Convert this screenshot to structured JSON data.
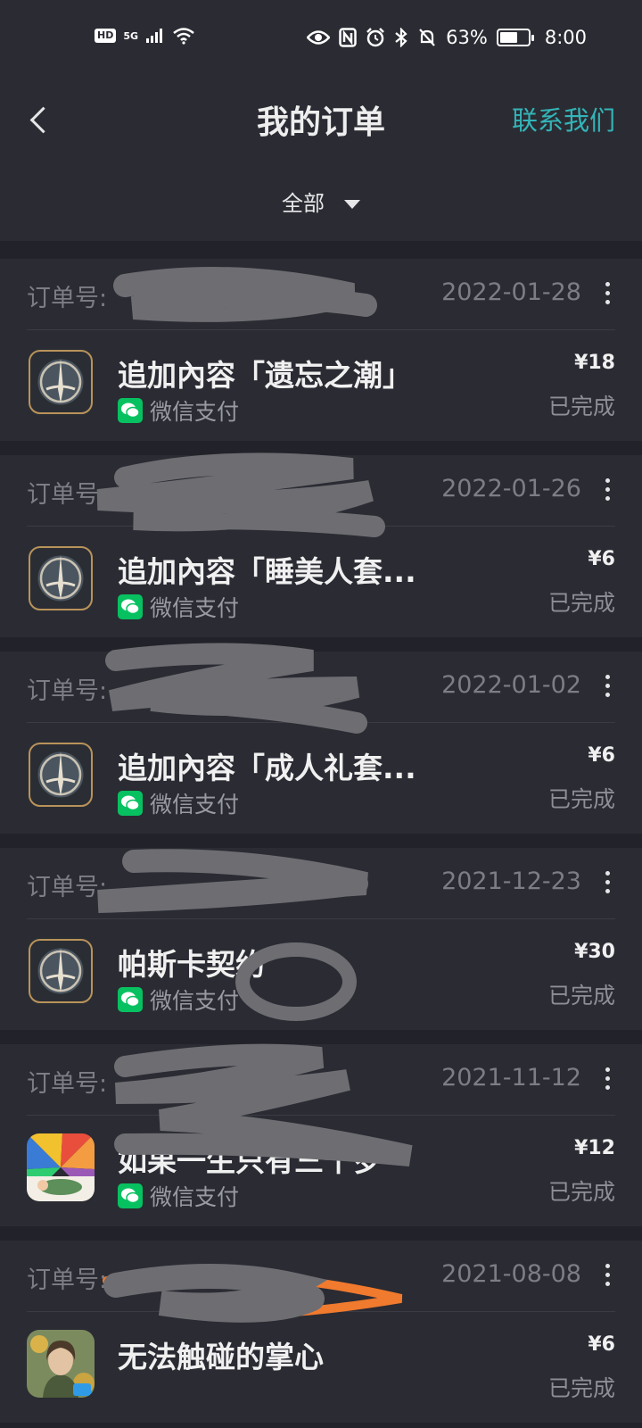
{
  "status_bar": {
    "left_badges": [
      "HD",
      "5G"
    ],
    "battery_percent": "63%",
    "battery_level": 0.63,
    "time": "8:00"
  },
  "header": {
    "title": "我的订单",
    "contact_link": "联系我们",
    "filter_label": "全部"
  },
  "colors": {
    "background": "#22232a",
    "card": "#2a2b33",
    "accent": "#33b4b8",
    "wechat_green": "#07c160",
    "scribble_gray": "#6d6d72",
    "scribble_orange": "#f07a2d"
  },
  "orders": [
    {
      "order_no_label": "订单号:",
      "date": "2022-01-28",
      "title": "追加內容「遗忘之潮」",
      "payment": "微信支付",
      "price": "¥18",
      "status": "已完成",
      "icon": "dark-shield-game-icon"
    },
    {
      "order_no_label": "订单号:",
      "date": "2022-01-26",
      "title": "追加內容「睡美人套...",
      "payment": "微信支付",
      "price": "¥6",
      "status": "已完成",
      "icon": "dark-shield-game-icon"
    },
    {
      "order_no_label": "订单号:",
      "date": "2022-01-02",
      "title": "追加內容「成人礼套...",
      "payment": "微信支付",
      "price": "¥6",
      "status": "已完成",
      "icon": "dark-shield-game-icon"
    },
    {
      "order_no_label": "订单号:",
      "date": "2021-12-23",
      "title": "帕斯卡契约",
      "payment": "微信支付",
      "price": "¥30",
      "status": "已完成",
      "icon": "dark-shield-game-icon"
    },
    {
      "order_no_label": "订单号:",
      "date": "2021-11-12",
      "title": "如果一生只有三十岁",
      "payment": "微信支付",
      "price": "¥12",
      "status": "已完成",
      "icon": "colorful-game-icon"
    },
    {
      "order_no_label": "订单号:",
      "date": "2021-08-08",
      "title": "无法触碰的掌心",
      "payment": "",
      "price": "¥6",
      "status": "已完成",
      "icon": "portrait-game-icon"
    }
  ]
}
